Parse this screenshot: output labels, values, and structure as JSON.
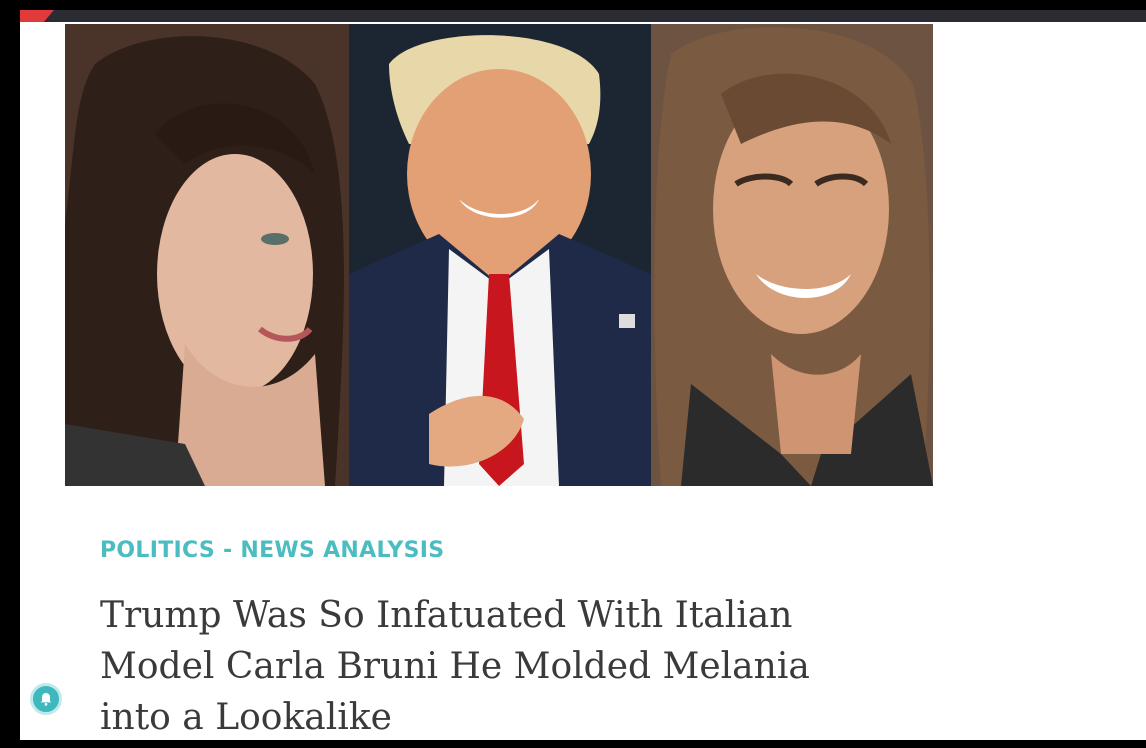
{
  "article": {
    "category": "POLITICS - NEWS ANALYSIS",
    "headline": "Trump Was So Infatuated With Italian Model Carla Bruni He Molded Melania into a Lookalike"
  },
  "notification": {
    "icon": "bell-icon"
  },
  "colors": {
    "accent": "#4bbdc0",
    "headline": "#3a3a3a",
    "top_bar": "#2b2b33",
    "top_bar_accent": "#e03a3a"
  }
}
